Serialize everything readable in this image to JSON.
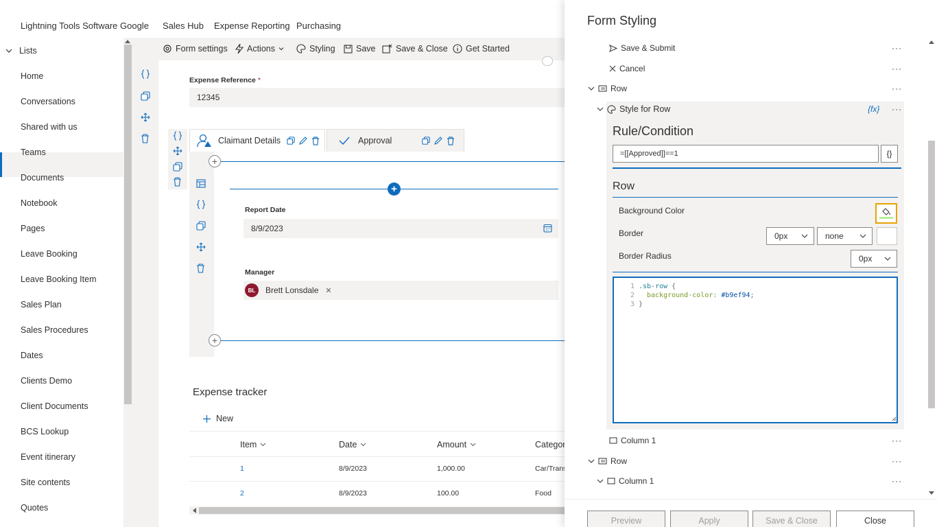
{
  "top_nav": {
    "items": [
      "Lightning Tools Software",
      "Google",
      "Sales Hub",
      "Expense Reporting",
      "Purchasing"
    ]
  },
  "sidebar": {
    "header": "Lists",
    "items": [
      "Home",
      "Conversations",
      "Shared with us",
      "Teams",
      "Documents",
      "Notebook",
      "Pages",
      "Leave Booking",
      "Leave Booking Item",
      "Sales Plan",
      "Sales Procedures",
      "Dates",
      "Clients Demo",
      "Client Documents",
      "BCS Lookup",
      "Event itinerary",
      "Site contents",
      "Quotes"
    ],
    "selected": "Shared with us"
  },
  "command_bar": {
    "form_settings": "Form settings",
    "actions": "Actions",
    "styling": "Styling",
    "save": "Save",
    "save_close": "Save & Close",
    "get_started": "Get Started"
  },
  "form": {
    "expense_reference": {
      "label": "Expense Reference",
      "required_mark": "*",
      "value": "12345"
    },
    "tabs": [
      {
        "label": "Claimant Details",
        "active": true
      },
      {
        "label": "Approval",
        "active": false
      }
    ],
    "report_date": {
      "label": "Report Date",
      "value": "8/9/2023"
    },
    "manager": {
      "label": "Manager",
      "initials": "BL",
      "name": "Brett Lonsdale",
      "remove": "✕"
    }
  },
  "tracker": {
    "title": "Expense tracker",
    "new_label": "New",
    "columns": [
      "Item",
      "Date",
      "Amount",
      "Categor"
    ],
    "rows": [
      {
        "item": "1",
        "date": "8/9/2023",
        "amount": "1,000.00",
        "category": "Car/Trans"
      },
      {
        "item": "2",
        "date": "8/9/2023",
        "amount": "100.00",
        "category": "Food"
      }
    ]
  },
  "panel": {
    "title": "Form Styling",
    "tree": {
      "save_submit": "Save & Submit",
      "cancel": "Cancel",
      "row1": "Row",
      "style_for_row": "Style for Row",
      "fx": "{fx}",
      "column1": "Column 1",
      "row2": "Row",
      "column1b": "Column 1",
      "more": "···"
    },
    "rule": {
      "heading": "Rule/Condition",
      "value": "=[[Approved]]==1",
      "fx_button": "{}"
    },
    "row_props": {
      "heading": "Row",
      "background_color": "Background Color",
      "border": "Border",
      "border_width": "0px",
      "border_style": "none",
      "border_radius": "Border Radius",
      "border_radius_value": "0px"
    },
    "code": {
      "line_numbers": [
        "1",
        "2",
        "3"
      ],
      "selector": ".sb-row",
      "open_brace": "{",
      "property": "background-color:",
      "value": "#b9ef94",
      "semicolon": ";",
      "close_brace": "}"
    },
    "footer": {
      "preview": "Preview",
      "apply": "Apply",
      "save_close": "Save & Close",
      "close": "Close"
    }
  },
  "colors": {
    "accent": "#0f6cbd",
    "highlight_border": "#e8a200",
    "avatar": "#8e192e",
    "code_bg_value": "#b9ef94"
  }
}
